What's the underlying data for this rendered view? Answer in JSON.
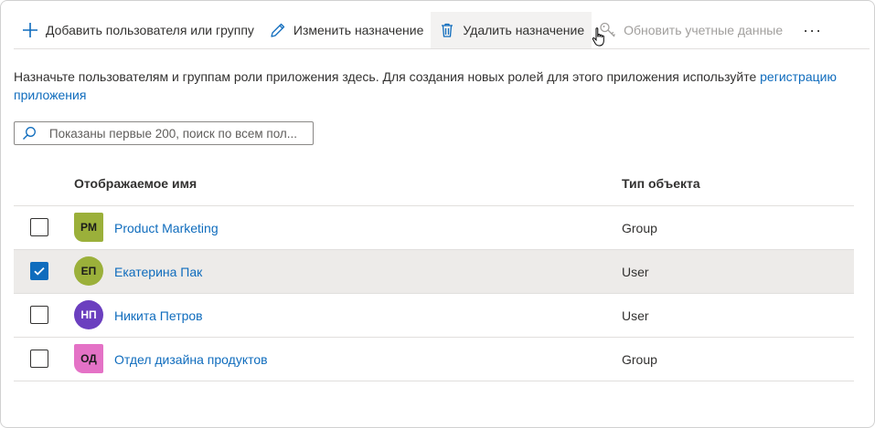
{
  "toolbar": {
    "add_label": "Добавить пользователя или группу",
    "edit_label": "Изменить назначение",
    "remove_label": "Удалить назначение",
    "update_label": "Обновить учетные данные",
    "more_label": "···"
  },
  "description": {
    "text": "Назначьте пользователям и группам роли приложения здесь. Для создания новых ролей для этого приложения используйте",
    "link": "регистрацию приложения"
  },
  "search": {
    "placeholder": "Показаны первые 200, поиск по всем пол..."
  },
  "table": {
    "columns": [
      "Отображаемое имя",
      "Тип объекта"
    ],
    "rows": [
      {
        "initials": "PM",
        "name": "Product Marketing",
        "type": "Group",
        "checked": false,
        "avatar_color": "#9bb03a"
      },
      {
        "initials": "ЕП",
        "name": "Екатерина Пак",
        "type": "User",
        "checked": true,
        "avatar_color": "#9bb03a"
      },
      {
        "initials": "НП",
        "name": "Никита Петров",
        "type": "User",
        "checked": false,
        "avatar_color": "#6b3fbf"
      },
      {
        "initials": "ОД",
        "name": "Отдел дизайна продуктов",
        "type": "Group",
        "checked": false,
        "avatar_color": "#e472c6"
      }
    ]
  },
  "colors": {
    "accent": "#0f6cbd",
    "selected_row": "#edebe9"
  }
}
